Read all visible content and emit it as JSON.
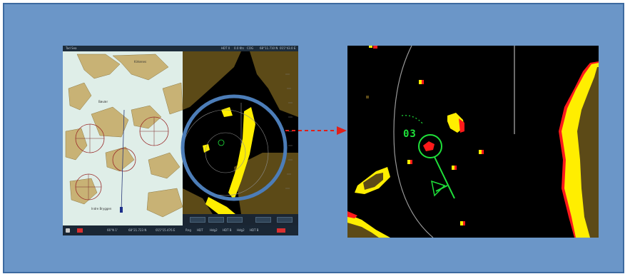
{
  "chart_window": {
    "title_left": "Tad Sea",
    "header_values": [
      "HDT 0",
      "0.0 Kts",
      "COG",
      "SOG"
    ],
    "header_coords": [
      "68°11.710 N",
      "015°43.0 E"
    ],
    "place_labels": [
      "Kirkenes",
      "Bøvær",
      "Indre Bryggen"
    ],
    "status_bar": {
      "position": "66°N 1'",
      "lat": "68°21.723 N",
      "lon": "015°15.476 E",
      "items": [
        "Rng",
        "HDT",
        "Hdg2",
        "HDT B",
        "Hdg2",
        "HDT B"
      ]
    }
  },
  "radar_zoom": {
    "target_id": "03"
  },
  "colors": {
    "frame_bg": "#6b96c8",
    "frame_border": "#3d6aa0",
    "land_chart": "#c8b275",
    "water_chart": "#dfeee8",
    "land_radar": "#5c4a17",
    "echo": "#ffee00",
    "echo_edge": "#ff1a1a",
    "target": "#1fe03a",
    "lens_ring": "#4c7db8",
    "arrow": "#e0201a"
  },
  "icons": {
    "arrow": "dashed-arrow-right-icon",
    "target": "tracked-target-icon"
  }
}
